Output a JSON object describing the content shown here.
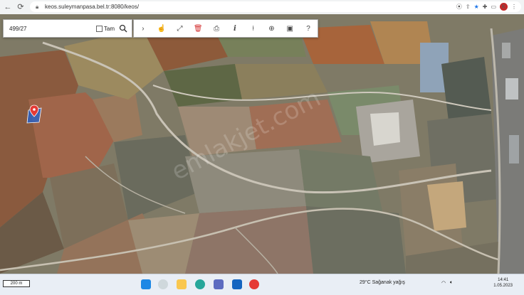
{
  "browser": {
    "url": "keos.suleymanpasa.bel.tr:8080/keos/",
    "profile_initial": "K",
    "icons": [
      "back-icon",
      "forward-icon",
      "reload-icon",
      "lock-icon",
      "location-icon",
      "share-icon",
      "star-icon",
      "extensions-icon",
      "sidebar-icon"
    ]
  },
  "search": {
    "parcel_value": "499/27",
    "checkbox_label": "Tam",
    "checkbox_checked": false
  },
  "toolbar": {
    "tools": [
      "chevron-right-icon",
      "hand-pointer-icon",
      "fullscreen-icon",
      "trash-icon",
      "print-icon",
      "info-icon",
      "pin-tool-icon",
      "compass-icon",
      "image-layer-icon",
      "help-icon"
    ]
  },
  "map": {
    "scale_label": "200 m",
    "watermark": "emlakjet.com",
    "marker_color": "#e53935",
    "parcel_highlight_color": "#1e63d6"
  },
  "taskbar": {
    "weather": "29°C  Sağanak yağış",
    "time": "14:41",
    "date": "1.05.2023"
  }
}
